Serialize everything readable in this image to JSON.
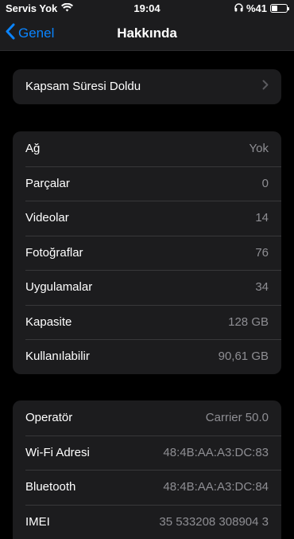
{
  "status_bar": {
    "carrier": "Servis Yok",
    "time": "19:04",
    "battery_text": "%41",
    "battery_level": 0.41
  },
  "nav": {
    "back_label": "Genel",
    "title": "Hakkında"
  },
  "coverage": {
    "label": "Kapsam Süresi Doldu"
  },
  "info": [
    {
      "label": "Ağ",
      "value": "Yok"
    },
    {
      "label": "Parçalar",
      "value": "0"
    },
    {
      "label": "Videolar",
      "value": "14"
    },
    {
      "label": "Fotoğraflar",
      "value": "76"
    },
    {
      "label": "Uygulamalar",
      "value": "34"
    },
    {
      "label": "Kapasite",
      "value": "128 GB"
    },
    {
      "label": "Kullanılabilir",
      "value": "90,61 GB"
    }
  ],
  "network": [
    {
      "label": "Operatör",
      "value": "Carrier 50.0"
    },
    {
      "label": "Wi-Fi Adresi",
      "value": "48:4B:AA:A3:DC:83"
    },
    {
      "label": "Bluetooth",
      "value": "48:4B:AA:A3:DC:84"
    },
    {
      "label": "IMEI",
      "value": "35 533208 308904 3"
    }
  ],
  "colors": {
    "accent": "#0a84ff",
    "background": "#000000",
    "card": "#1c1c1e",
    "secondary_text": "#8e8e93"
  }
}
